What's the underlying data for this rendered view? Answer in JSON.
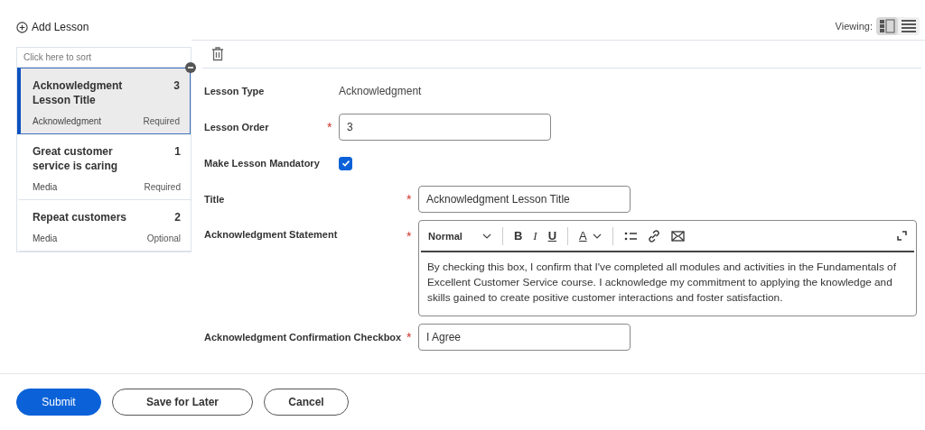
{
  "header": {
    "add_label": "Add Lesson",
    "viewing_label": "Viewing:",
    "views": [
      {
        "kind": "split",
        "selected": true
      },
      {
        "kind": "list",
        "selected": false
      }
    ]
  },
  "lessons": {
    "sort_hint": "Click here to sort",
    "items": [
      {
        "title": "Acknowledgment Lesson Title",
        "order": "3",
        "requirement": "Required",
        "type": "Acknowledgment",
        "selected": true
      },
      {
        "title": "Great customer service is caring",
        "order": "1",
        "requirement": "Required",
        "type": "Media",
        "selected": false
      },
      {
        "title": "Repeat customers",
        "order": "2",
        "requirement": "Optional",
        "type": "Media",
        "selected": false
      }
    ]
  },
  "form": {
    "lesson_type": {
      "label": "Lesson Type",
      "value": "Acknowledgment"
    },
    "lesson_order": {
      "label": "Lesson Order",
      "required_mark": "*",
      "value": "3"
    },
    "mandatory": {
      "label": "Make Lesson Mandatory",
      "checked": true
    },
    "title": {
      "label": "Title",
      "required_mark": "*",
      "value": "Acknowledgment Lesson Title"
    },
    "statement": {
      "label": "Acknowledgment Statement",
      "required_mark": "*",
      "style": "Normal",
      "toolbar": [
        {
          "kind": "bold",
          "label": "B"
        },
        {
          "kind": "italic",
          "label": "I"
        },
        {
          "kind": "underline",
          "label": "U"
        },
        {
          "kind": "sep"
        },
        {
          "kind": "color",
          "label": "A"
        },
        {
          "kind": "sep"
        },
        {
          "kind": "list"
        },
        {
          "kind": "link"
        },
        {
          "kind": "mail"
        }
      ],
      "text": "By checking this box, I confirm that I've completed all modules and activities in the Fundamentals of Excellent Customer Service course. I acknowledge my commitment to applying the knowledge and skills gained to create positive customer interactions and foster satisfaction."
    },
    "confirmation": {
      "label": "Acknowledgment Confirmation Checkbox",
      "required_mark": "*",
      "value": "I Agree"
    }
  },
  "buttons": [
    {
      "label": "Submit",
      "primary": true
    },
    {
      "label": "Save for Later",
      "primary": false
    },
    {
      "label": "Cancel",
      "primary": false
    }
  ]
}
